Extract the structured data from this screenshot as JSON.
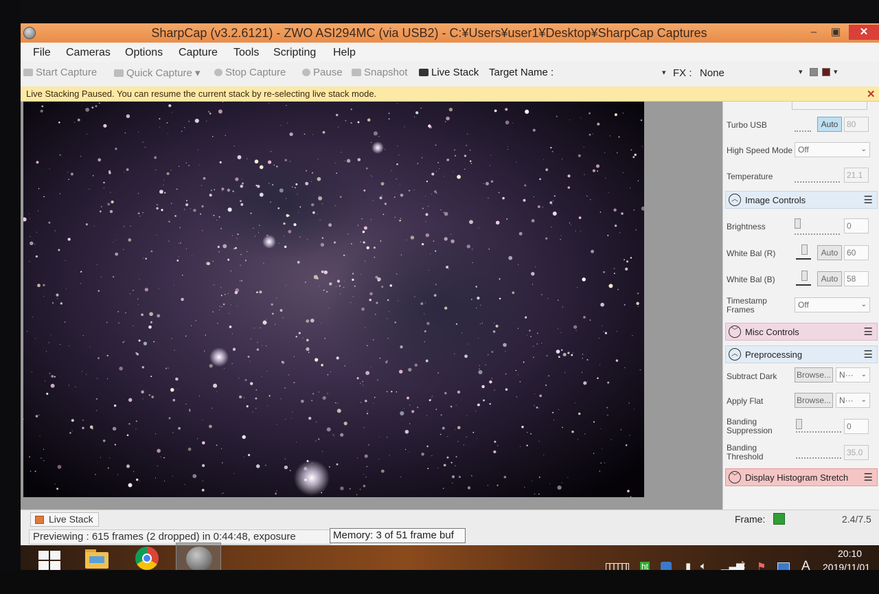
{
  "window": {
    "title": "SharpCap (v3.2.6121) - ZWO ASI294MC (via USB2) - C:¥Users¥user1¥Desktop¥SharpCap Captures",
    "minimize": "–",
    "maximize": "▣",
    "close": "✕"
  },
  "menu": [
    "File",
    "Cameras",
    "Options",
    "Capture",
    "Tools",
    "Scripting",
    "Help"
  ],
  "toolbar": {
    "start_capture": "Start Capture",
    "quick_capture": "Quick Capture",
    "stop_capture": "Stop Capture",
    "pause": "Pause",
    "snapshot": "Snapshot",
    "live_stack": "Live Stack",
    "target_name": "Target Name :",
    "fx_label": "FX :",
    "fx_value": "None",
    "caret": "▾"
  },
  "notification": {
    "message": "Live Stacking Paused. You can resume the current stack by re-selecting live stack mode.",
    "close": "✕"
  },
  "panel": {
    "turbo_usb": {
      "label": "Turbo USB",
      "auto": "Auto",
      "value": "80"
    },
    "high_speed_mode": {
      "label": "High Speed Mode",
      "value": "Off"
    },
    "temperature": {
      "label": "Temperature",
      "value": "21.1"
    },
    "image_controls": {
      "title": "Image Controls"
    },
    "brightness": {
      "label": "Brightness",
      "value": "0"
    },
    "white_bal_r": {
      "label": "White Bal (R)",
      "auto": "Auto",
      "value": "60"
    },
    "white_bal_b": {
      "label": "White Bal (B)",
      "auto": "Auto",
      "value": "58"
    },
    "timestamp_frames": {
      "label": "Timestamp Frames",
      "value": "Off"
    },
    "misc_controls": {
      "title": "Misc Controls"
    },
    "preprocessing": {
      "title": "Preprocessing"
    },
    "subtract_dark": {
      "label": "Subtract Dark",
      "button": "Browse...",
      "value": "N···"
    },
    "apply_flat": {
      "label": "Apply Flat",
      "button": "Browse...",
      "value": "N···"
    },
    "banding_suppression": {
      "label": "Banding Suppression",
      "value": "0"
    },
    "banding_threshold": {
      "label": "Banding Threshold",
      "value": "35.0"
    },
    "display_histogram_stretch": {
      "title": "Display Histogram Stretch"
    }
  },
  "bottom": {
    "live_stack_tab": "Live Stack",
    "frame_label": "Frame:",
    "frame_value": "2.4/7.5",
    "status": "Previewing : 615 frames (2 dropped) in 0:44:48, exposure",
    "memory": "Memory: 3 of 51 frame buf"
  },
  "taskbar": {
    "time": "20:10",
    "date": "2019/11/01",
    "ime": "A"
  },
  "colors": {
    "titlebar": "#e98c48",
    "notification": "#fce9a6",
    "frame_indicator": "#2f9e35",
    "close_button": "#d9403a"
  },
  "icons": [
    "sharpcap-icon",
    "camera-icon",
    "stop-icon",
    "pause-icon",
    "snapshot-icon",
    "live-stack-icon",
    "hamburger-icon",
    "chevron-up-icon",
    "chevron-down-icon",
    "windows-start-icon",
    "file-explorer-icon",
    "chrome-icon",
    "keyboard-icon",
    "battery-icon",
    "volume-icon",
    "network-icon",
    "bluetooth-icon"
  ]
}
